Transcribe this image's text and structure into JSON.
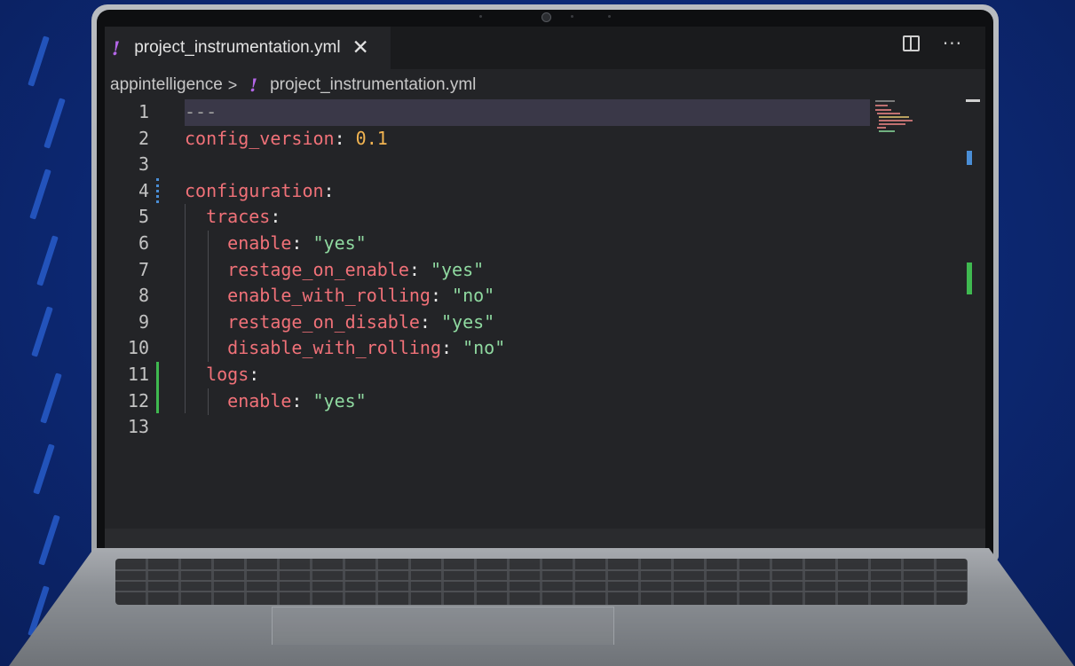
{
  "tab": {
    "filename": "project_instrumentation.yml",
    "close_icon": "✕",
    "file_icon": "!"
  },
  "toolbar": {
    "split_editor_icon": "split-editor-icon",
    "more_actions_icon": "···"
  },
  "breadcrumb": {
    "folder": "appintelligence",
    "separator": ">",
    "file_icon": "!",
    "file": "project_instrumentation.yml"
  },
  "editor": {
    "current_line": 1,
    "lines": [
      {
        "num": "1",
        "tokens": [
          [
            "d",
            "---"
          ]
        ]
      },
      {
        "num": "2",
        "tokens": [
          [
            "k",
            "config_version"
          ],
          [
            "p",
            ": "
          ],
          [
            "n",
            "0.1"
          ]
        ]
      },
      {
        "num": "3",
        "tokens": []
      },
      {
        "num": "4",
        "tokens": [
          [
            "k",
            "configuration"
          ],
          [
            "p",
            ":"
          ]
        ]
      },
      {
        "num": "5",
        "tokens": [
          [
            "p",
            "  "
          ],
          [
            "k",
            "traces"
          ],
          [
            "p",
            ":"
          ]
        ]
      },
      {
        "num": "6",
        "tokens": [
          [
            "p",
            "    "
          ],
          [
            "k",
            "enable"
          ],
          [
            "p",
            ": "
          ],
          [
            "s",
            "\"yes\""
          ]
        ]
      },
      {
        "num": "7",
        "tokens": [
          [
            "p",
            "    "
          ],
          [
            "k",
            "restage_on_enable"
          ],
          [
            "p",
            ": "
          ],
          [
            "s",
            "\"yes\""
          ]
        ]
      },
      {
        "num": "8",
        "tokens": [
          [
            "p",
            "    "
          ],
          [
            "k",
            "enable_with_rolling"
          ],
          [
            "p",
            ": "
          ],
          [
            "s",
            "\"no\""
          ]
        ]
      },
      {
        "num": "9",
        "tokens": [
          [
            "p",
            "    "
          ],
          [
            "k",
            "restage_on_disable"
          ],
          [
            "p",
            ": "
          ],
          [
            "s",
            "\"yes\""
          ]
        ]
      },
      {
        "num": "10",
        "tokens": [
          [
            "p",
            "    "
          ],
          [
            "k",
            "disable_with_rolling"
          ],
          [
            "p",
            ": "
          ],
          [
            "s",
            "\"no\""
          ]
        ]
      },
      {
        "num": "11",
        "tokens": [
          [
            "p",
            "  "
          ],
          [
            "k",
            "logs"
          ],
          [
            "p",
            ":"
          ]
        ]
      },
      {
        "num": "12",
        "tokens": [
          [
            "p",
            "    "
          ],
          [
            "k",
            "enable"
          ],
          [
            "p",
            ": "
          ],
          [
            "s",
            "\"yes\""
          ]
        ]
      },
      {
        "num": "13",
        "tokens": []
      }
    ]
  },
  "colors": {
    "key": "#f07178",
    "string": "#8fd9a0",
    "number": "#f2b451",
    "gutter_added": "#3fb950",
    "gutter_modified": "#4a8ed6",
    "yml_icon": "#b466e8"
  }
}
